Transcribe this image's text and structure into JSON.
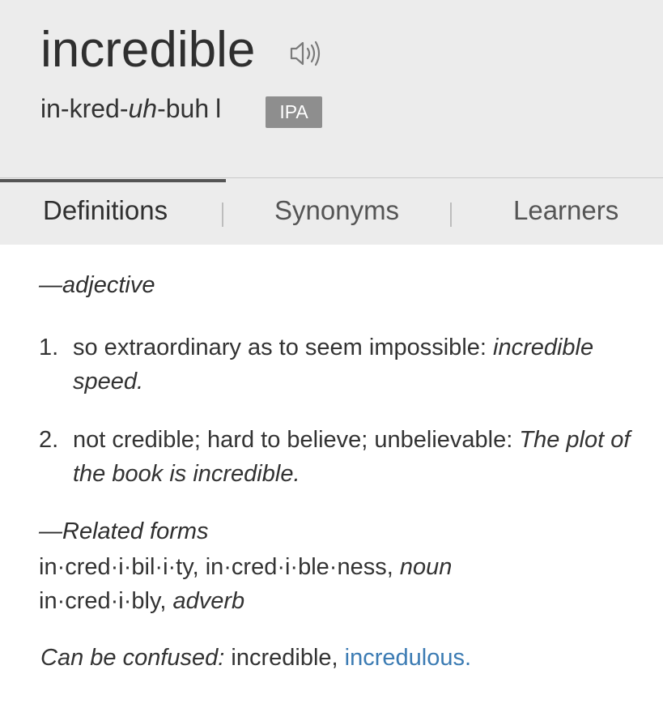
{
  "entry": {
    "headword": "incredible",
    "speaker_icon": "speaker-sound-icon",
    "pron_parts": [
      "in-kred-",
      "uh",
      "-buh"
    ],
    "pron_bar": "l",
    "ipa_label": "IPA"
  },
  "tabs": [
    {
      "label": "Definitions",
      "active": true
    },
    {
      "label": "Synonyms",
      "active": false
    },
    {
      "label": "Learners",
      "active": false
    }
  ],
  "definitions": {
    "pos": "—adjective",
    "items": [
      {
        "num": "1.",
        "text": "so extraordinary as to seem impossible: ",
        "example": "incredible speed."
      },
      {
        "num": "2.",
        "text": "not credible; hard to believe; unbelievable: ",
        "example": "The plot of the book is incredible."
      }
    ]
  },
  "related": {
    "heading": "—Related forms",
    "lines": [
      {
        "forms": "in·cred·i·bil·i·ty, in·cred·i·ble·ness,",
        "pos": "noun"
      },
      {
        "forms": "in·cred·i·bly,",
        "pos": "adverb"
      }
    ]
  },
  "confused": {
    "label": "Can be confused:",
    "word": "incredible,",
    "link": "incredulous."
  },
  "colors": {
    "header_bg": "#ececec",
    "ipa_bg": "#8e8e8e",
    "link": "#3b7bb3"
  }
}
